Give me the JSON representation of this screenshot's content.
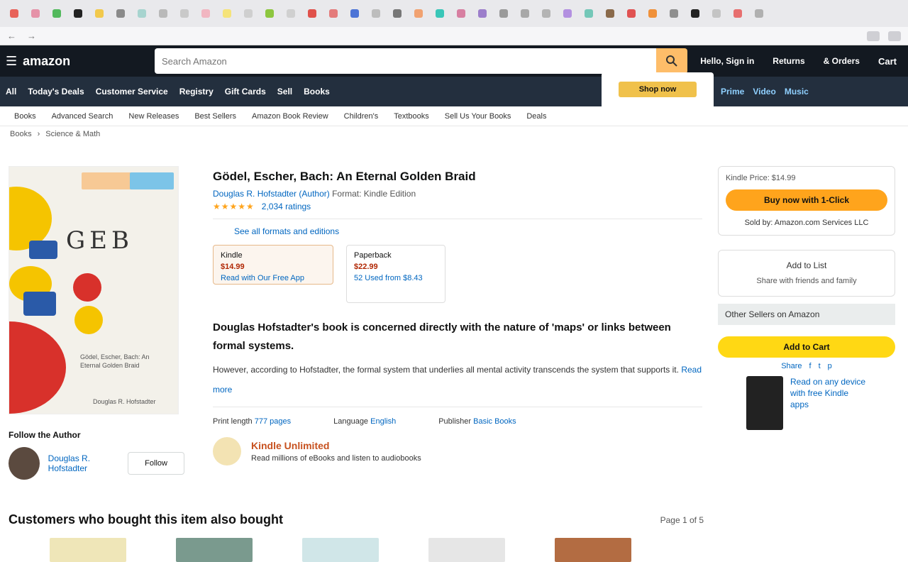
{
  "browser": {
    "tabs": [
      {
        "icon": "red-favicon-icon",
        "color": "#e8635a"
      },
      {
        "icon": "pink-favicon-icon",
        "color": "#e592a8"
      },
      {
        "icon": "green-favicon-icon",
        "color": "#53b95d"
      },
      {
        "icon": "github-favicon-icon",
        "color": "#222222"
      },
      {
        "icon": "yellow-favicon-icon",
        "color": "#f2c94c"
      },
      {
        "icon": "grey-favicon-icon",
        "color": "#8a8a8a"
      },
      {
        "icon": "teal-favicon-icon",
        "color": "#a7d4cf"
      },
      {
        "icon": "grey-favicon-icon",
        "color": "#b9b9b9"
      },
      {
        "icon": "grey-favicon-icon",
        "color": "#c9c9c9"
      },
      {
        "icon": "pink-favicon-icon",
        "color": "#f1b6c1"
      },
      {
        "icon": "yellow-favicon-icon",
        "color": "#f5e37a"
      },
      {
        "icon": "grey-favicon-icon",
        "color": "#cfcfcf"
      },
      {
        "icon": "green-favicon-icon",
        "color": "#8dc63f"
      },
      {
        "icon": "grey-favicon-icon",
        "color": "#d0d0d0"
      },
      {
        "icon": "red-favicon-icon",
        "color": "#e0514b"
      },
      {
        "icon": "red-favicon-icon",
        "color": "#e47b7b"
      },
      {
        "icon": "blue-favicon-icon",
        "color": "#4d74d6"
      },
      {
        "icon": "grey-favicon-icon",
        "color": "#bdbdbd"
      },
      {
        "icon": "grey-favicon-icon",
        "color": "#777777"
      },
      {
        "icon": "orange-favicon-icon",
        "color": "#f1a271"
      },
      {
        "icon": "teal-favicon-icon",
        "color": "#39c6b8"
      },
      {
        "icon": "pink-favicon-icon",
        "color": "#d77fa1"
      },
      {
        "icon": "purple-favicon-icon",
        "color": "#9c7ecb"
      },
      {
        "icon": "grey-favicon-icon",
        "color": "#9a9a9a"
      },
      {
        "icon": "grey-favicon-icon",
        "color": "#a8a8a8"
      },
      {
        "icon": "grey-favicon-icon",
        "color": "#b4b4b4"
      },
      {
        "icon": "purple-favicon-icon",
        "color": "#b390e0"
      },
      {
        "icon": "teal-favicon-icon",
        "color": "#74c7b8"
      },
      {
        "icon": "brown-favicon-icon",
        "color": "#8a6a4b"
      },
      {
        "icon": "red-favicon-icon",
        "color": "#e05252"
      },
      {
        "icon": "orange-favicon-icon",
        "color": "#f0913a"
      },
      {
        "icon": "grey-favicon-icon",
        "color": "#8f8f8f"
      },
      {
        "icon": "github-favicon-icon",
        "color": "#222222"
      },
      {
        "icon": "grey-favicon-icon",
        "color": "#c4c4c4"
      },
      {
        "icon": "red-favicon-icon",
        "color": "#e76f6f"
      },
      {
        "icon": "grey-favicon-icon",
        "color": "#b0b0b0"
      }
    ]
  },
  "header": {
    "brand": "amazon",
    "search_placeholder": "Search Amazon",
    "links": [
      "Hello, Sign in",
      "Returns",
      "& Orders",
      "Cart"
    ]
  },
  "nav": {
    "menu_label": "All",
    "items": [
      "Today's Deals",
      "Customer Service",
      "Registry",
      "Gift Cards",
      "Sell",
      "Books"
    ],
    "promo": "Shop now",
    "right_items": [
      "Prime",
      "Video",
      "Music"
    ]
  },
  "subnav": [
    "Books",
    "Advanced Search",
    "New Releases",
    "Best Sellers",
    "Amazon Book Review",
    "Children's",
    "Textbooks",
    "Sell Us Your Books",
    "Deals"
  ],
  "breadcrumb": [
    "Books",
    "›",
    "Science & Math"
  ],
  "book": {
    "cover_title": "GEB",
    "cover_author": "Douglas R. Hofstadter",
    "title": "Gödel, Escher, Bach: An Eternal Golden Braid",
    "by": "Douglas R. Hofstadter (Author)",
    "edition": "Format: Kindle Edition",
    "stars": "★★★★★",
    "ratings": "2,034 ratings",
    "see_formats": "See all formats and editions",
    "format_main": {
      "name": "Kindle",
      "price": "$14.99",
      "note": "Read with Our Free App"
    },
    "format_alt": {
      "name": "Paperback",
      "price": "$22.99",
      "other": "52 Used from $8.43"
    },
    "description_head": "Douglas Hofstadter's book is concerned directly with the nature of 'maps' or links between formal systems.",
    "description": "However, according to Hofstadter, the formal system that underlies all mental activity transcends the system that supports it.",
    "read_more": "Read more",
    "details": [
      {
        "k": "Print length",
        "v": "777 pages"
      },
      {
        "k": "Language",
        "v": "English"
      },
      {
        "k": "Publisher",
        "v": "Basic Books"
      }
    ],
    "promo_title": "Kindle Unlimited",
    "promo_text": "Read millions of eBooks and listen to audiobooks",
    "read_more_author": "Follow the Author",
    "author_name": "Douglas R. Hofstadter",
    "follow": "Follow"
  },
  "buybox": {
    "label": "Kindle Price: $14.99",
    "buy": "Buy now with 1-Click",
    "note": "Sold by: Amazon.com Services LLC",
    "list_title": "Add to List",
    "list_text": "Share with friends and family",
    "other_sellers": "Other Sellers on Amazon",
    "add_cart": "Add to Cart",
    "share": [
      "Share",
      "f",
      "t",
      "p"
    ],
    "kindle_text": "Read on any device with free Kindle apps"
  },
  "carousel": {
    "heading": "Customers who bought this item also bought",
    "page": "Page 1 of 5",
    "items": [
      {
        "color": "#efe6b8"
      },
      {
        "color": "#7a9a8e"
      },
      {
        "color": "#d0e6e8"
      },
      {
        "color": "#e6e6e6"
      },
      {
        "color": "#b36c42"
      }
    ]
  }
}
